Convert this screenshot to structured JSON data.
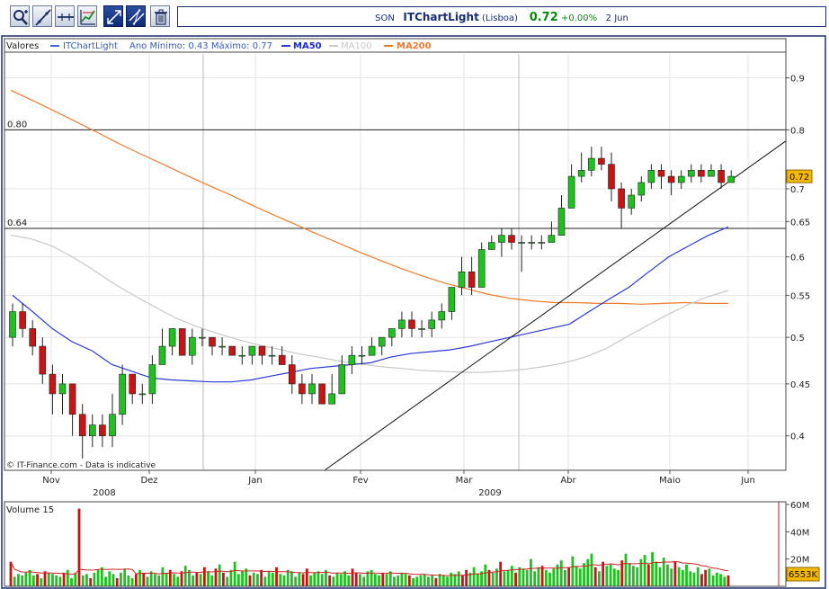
{
  "toolbar": {
    "buttons": [
      {
        "id": "zoom",
        "icon": "zoom-in-icon"
      },
      {
        "id": "line",
        "icon": "trend-line-icon"
      },
      {
        "id": "hline",
        "icon": "horizontal-line-icon"
      },
      {
        "id": "indicators",
        "icon": "indicator-chart-icon"
      },
      {
        "id": "fib",
        "icon": "diagonal-arrows-icon"
      },
      {
        "id": "fib2",
        "icon": "parallel-lines-icon"
      },
      {
        "id": "delete",
        "icon": "trash-icon"
      }
    ]
  },
  "quote": {
    "symbol": "SON",
    "name": "ITChartLight",
    "exchange": "(Lisboa)",
    "price": "0.72",
    "change": "+0.00%",
    "date": "2 Jun"
  },
  "colors": {
    "up": "#20c020",
    "down": "#c81414",
    "ma50": "#2a3ad8",
    "ma100": "#c8c8c8",
    "ma200": "#f07a2a",
    "volume_ma": "#d02020",
    "frame": "#1a2f78"
  },
  "legend": {
    "valores": "Valores",
    "series": "ITChartLight",
    "range": "Ano Mínimo: 0.43 Máximo: 0.77",
    "ma50": "MA50",
    "ma100": "MA100",
    "ma200": "MA200"
  },
  "volume_legend": "Volume 15",
  "copyright": "© IT-Finance.com - Data is indicative",
  "chart_data": {
    "type": "candlestick",
    "y_ticks": [
      "0.9",
      "0.8",
      "0.7",
      "0.65",
      "0.6",
      "0.55",
      "0.5",
      "0.45",
      "0.4"
    ],
    "y_scale": "log",
    "y_range": [
      0.37,
      0.95
    ],
    "current_price_label": "0.72",
    "horizontal_lines": [
      {
        "label": "0.80",
        "value": 0.8
      },
      {
        "label": "0.64",
        "value": 0.64
      }
    ],
    "trend_line": {
      "from": {
        "week_index": 13.85,
        "value": 0.37
      },
      "to": {
        "week_index": 32.1,
        "value": 0.78
      }
    },
    "months": [
      "Nov",
      "Dez",
      "Jan",
      "Fev",
      "Mar",
      "Abr",
      "Maio",
      "Jun"
    ],
    "years": [
      "2008",
      "2009"
    ],
    "candles": [
      [
        0.5,
        0.53,
        0.54,
        0.49
      ],
      [
        0.53,
        0.51,
        0.54,
        0.5
      ],
      [
        0.51,
        0.49,
        0.52,
        0.48
      ],
      [
        0.49,
        0.46,
        0.5,
        0.45
      ],
      [
        0.46,
        0.44,
        0.47,
        0.42
      ],
      [
        0.44,
        0.45,
        0.46,
        0.42
      ],
      [
        0.45,
        0.42,
        0.45,
        0.4
      ],
      [
        0.42,
        0.4,
        0.43,
        0.38
      ],
      [
        0.4,
        0.41,
        0.42,
        0.39
      ],
      [
        0.41,
        0.4,
        0.42,
        0.39
      ],
      [
        0.4,
        0.42,
        0.44,
        0.39
      ],
      [
        0.42,
        0.46,
        0.47,
        0.41
      ],
      [
        0.46,
        0.44,
        0.46,
        0.43
      ],
      [
        0.44,
        0.44,
        0.45,
        0.43
      ],
      [
        0.44,
        0.47,
        0.48,
        0.43
      ],
      [
        0.47,
        0.49,
        0.51,
        0.47
      ],
      [
        0.49,
        0.51,
        0.51,
        0.48
      ],
      [
        0.51,
        0.48,
        0.51,
        0.48
      ],
      [
        0.48,
        0.5,
        0.51,
        0.47
      ],
      [
        0.5,
        0.5,
        0.51,
        0.49
      ],
      [
        0.5,
        0.49,
        0.5,
        0.48
      ],
      [
        0.49,
        0.49,
        0.5,
        0.48
      ],
      [
        0.49,
        0.48,
        0.49,
        0.48
      ],
      [
        0.48,
        0.48,
        0.49,
        0.47
      ],
      [
        0.48,
        0.49,
        0.49,
        0.47
      ],
      [
        0.49,
        0.48,
        0.49,
        0.47
      ],
      [
        0.48,
        0.48,
        0.49,
        0.47
      ],
      [
        0.48,
        0.47,
        0.49,
        0.47
      ],
      [
        0.47,
        0.45,
        0.48,
        0.44
      ],
      [
        0.45,
        0.44,
        0.46,
        0.43
      ],
      [
        0.44,
        0.45,
        0.46,
        0.43
      ],
      [
        0.45,
        0.43,
        0.45,
        0.43
      ],
      [
        0.43,
        0.44,
        0.46,
        0.43
      ],
      [
        0.44,
        0.47,
        0.48,
        0.44
      ],
      [
        0.47,
        0.48,
        0.49,
        0.46
      ],
      [
        0.48,
        0.48,
        0.49,
        0.47
      ],
      [
        0.48,
        0.49,
        0.5,
        0.48
      ],
      [
        0.49,
        0.5,
        0.5,
        0.48
      ],
      [
        0.5,
        0.51,
        0.51,
        0.49
      ],
      [
        0.51,
        0.52,
        0.53,
        0.5
      ],
      [
        0.52,
        0.51,
        0.53,
        0.5
      ],
      [
        0.51,
        0.51,
        0.52,
        0.5
      ],
      [
        0.51,
        0.52,
        0.53,
        0.5
      ],
      [
        0.52,
        0.53,
        0.54,
        0.51
      ],
      [
        0.53,
        0.56,
        0.56,
        0.52
      ],
      [
        0.56,
        0.58,
        0.6,
        0.55
      ],
      [
        0.58,
        0.56,
        0.6,
        0.55
      ],
      [
        0.56,
        0.61,
        0.62,
        0.56
      ],
      [
        0.61,
        0.62,
        0.63,
        0.61
      ],
      [
        0.62,
        0.63,
        0.64,
        0.6
      ],
      [
        0.63,
        0.62,
        0.64,
        0.61
      ],
      [
        0.62,
        0.62,
        0.63,
        0.58
      ],
      [
        0.62,
        0.62,
        0.63,
        0.61
      ],
      [
        0.62,
        0.62,
        0.63,
        0.61
      ],
      [
        0.62,
        0.63,
        0.65,
        0.62
      ],
      [
        0.63,
        0.67,
        0.69,
        0.63
      ],
      [
        0.67,
        0.72,
        0.74,
        0.67
      ],
      [
        0.72,
        0.73,
        0.76,
        0.71
      ],
      [
        0.73,
        0.75,
        0.77,
        0.72
      ],
      [
        0.75,
        0.74,
        0.77,
        0.73
      ],
      [
        0.74,
        0.7,
        0.76,
        0.68
      ],
      [
        0.7,
        0.67,
        0.71,
        0.64
      ],
      [
        0.67,
        0.69,
        0.7,
        0.66
      ],
      [
        0.69,
        0.71,
        0.72,
        0.68
      ],
      [
        0.71,
        0.73,
        0.74,
        0.7
      ],
      [
        0.73,
        0.72,
        0.74,
        0.7
      ],
      [
        0.72,
        0.71,
        0.73,
        0.69
      ],
      [
        0.71,
        0.72,
        0.73,
        0.7
      ],
      [
        0.72,
        0.73,
        0.74,
        0.71
      ],
      [
        0.73,
        0.72,
        0.74,
        0.71
      ],
      [
        0.72,
        0.73,
        0.74,
        0.72
      ],
      [
        0.73,
        0.71,
        0.74,
        0.7
      ],
      [
        0.71,
        0.72,
        0.73,
        0.71
      ]
    ],
    "ma50": [
      0.55,
      0.53,
      0.51,
      0.495,
      0.485,
      0.47,
      0.463,
      0.456,
      0.454,
      0.453,
      0.452,
      0.452,
      0.454,
      0.458,
      0.462,
      0.466,
      0.468,
      0.47,
      0.472,
      0.478,
      0.482,
      0.484,
      0.486,
      0.49,
      0.495,
      0.5,
      0.505,
      0.51,
      0.515,
      0.53,
      0.545,
      0.56,
      0.58,
      0.6,
      0.615,
      0.63,
      0.642
    ],
    "ma100": [
      0.63,
      0.625,
      0.615,
      0.6,
      0.583,
      0.565,
      0.55,
      0.536,
      0.523,
      0.513,
      0.505,
      0.498,
      0.492,
      0.487,
      0.482,
      0.478,
      0.474,
      0.471,
      0.468,
      0.466,
      0.464,
      0.463,
      0.462,
      0.462,
      0.463,
      0.465,
      0.468,
      0.472,
      0.478,
      0.487,
      0.5,
      0.513,
      0.526,
      0.538,
      0.548,
      0.556
    ],
    "ma200": [
      0.875,
      0.855,
      0.835,
      0.815,
      0.795,
      0.775,
      0.757,
      0.74,
      0.723,
      0.707,
      0.692,
      0.676,
      0.661,
      0.647,
      0.633,
      0.62,
      0.607,
      0.595,
      0.584,
      0.574,
      0.565,
      0.558,
      0.551,
      0.546,
      0.543,
      0.541,
      0.541,
      0.54,
      0.54,
      0.539,
      0.54,
      0.541,
      0.54,
      0.54
    ],
    "volume": {
      "y_ticks": [
        "60M",
        "40M",
        "20M"
      ],
      "y_range": [
        0,
        62
      ],
      "current_label": "6553K",
      "values": [
        18,
        7,
        9,
        8,
        10,
        12,
        8,
        9,
        6,
        11,
        10,
        9,
        8,
        7,
        10,
        12,
        6,
        10,
        57,
        8,
        9,
        6,
        10,
        12,
        14,
        7,
        11,
        9,
        6,
        10,
        13,
        8,
        6,
        9,
        12,
        10,
        7,
        11,
        9,
        8,
        14,
        10,
        12,
        9,
        7,
        11,
        15,
        12,
        8,
        10,
        9,
        14,
        11,
        8,
        13,
        16,
        10,
        7,
        12,
        18,
        9,
        11,
        13,
        8,
        10,
        9,
        12,
        7,
        11,
        10,
        14,
        9,
        8,
        12,
        11,
        7,
        10,
        9,
        13,
        8,
        10,
        11,
        9,
        12,
        8,
        7,
        10,
        9,
        11,
        8,
        13,
        10,
        9,
        7,
        11,
        12,
        9,
        8,
        10,
        9,
        11,
        7,
        8,
        10,
        9,
        8,
        6,
        7,
        8,
        9,
        7,
        8,
        6,
        9,
        8,
        7,
        10,
        9,
        11,
        8,
        12,
        10,
        14,
        9,
        11,
        16,
        12,
        10,
        13,
        18,
        11,
        12,
        15,
        10,
        14,
        13,
        12,
        20,
        11,
        14,
        15,
        12,
        10,
        13,
        16,
        19,
        12,
        14,
        22,
        15,
        13,
        17,
        20,
        24,
        14,
        11,
        18,
        15,
        16,
        13,
        12,
        19,
        24,
        17,
        15,
        14,
        20,
        23,
        16,
        25,
        18,
        14,
        21,
        16,
        13,
        18,
        14,
        12,
        16,
        11,
        10,
        14,
        9,
        12,
        13,
        8,
        10,
        9,
        7,
        8
      ]
    }
  }
}
